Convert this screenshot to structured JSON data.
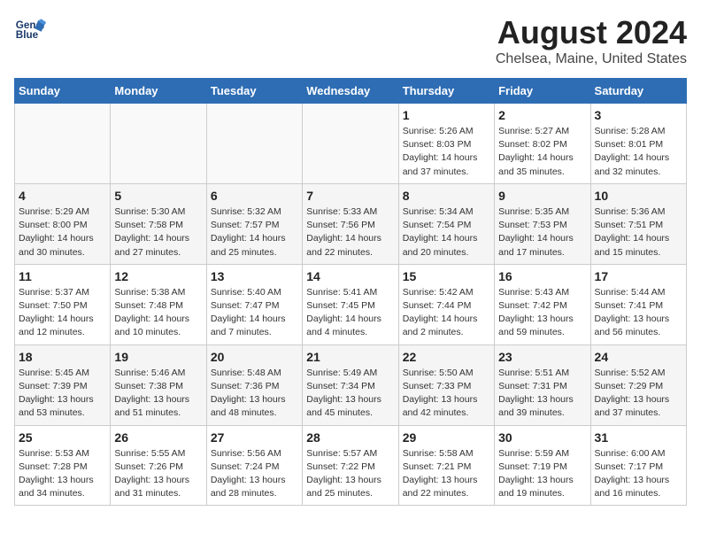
{
  "header": {
    "logo_line1": "General",
    "logo_line2": "Blue",
    "title": "August 2024",
    "subtitle": "Chelsea, Maine, United States"
  },
  "days_of_week": [
    "Sunday",
    "Monday",
    "Tuesday",
    "Wednesday",
    "Thursday",
    "Friday",
    "Saturday"
  ],
  "weeks": [
    [
      {
        "day": "",
        "info": ""
      },
      {
        "day": "",
        "info": ""
      },
      {
        "day": "",
        "info": ""
      },
      {
        "day": "",
        "info": ""
      },
      {
        "day": "1",
        "info": "Sunrise: 5:26 AM\nSunset: 8:03 PM\nDaylight: 14 hours\nand 37 minutes."
      },
      {
        "day": "2",
        "info": "Sunrise: 5:27 AM\nSunset: 8:02 PM\nDaylight: 14 hours\nand 35 minutes."
      },
      {
        "day": "3",
        "info": "Sunrise: 5:28 AM\nSunset: 8:01 PM\nDaylight: 14 hours\nand 32 minutes."
      }
    ],
    [
      {
        "day": "4",
        "info": "Sunrise: 5:29 AM\nSunset: 8:00 PM\nDaylight: 14 hours\nand 30 minutes."
      },
      {
        "day": "5",
        "info": "Sunrise: 5:30 AM\nSunset: 7:58 PM\nDaylight: 14 hours\nand 27 minutes."
      },
      {
        "day": "6",
        "info": "Sunrise: 5:32 AM\nSunset: 7:57 PM\nDaylight: 14 hours\nand 25 minutes."
      },
      {
        "day": "7",
        "info": "Sunrise: 5:33 AM\nSunset: 7:56 PM\nDaylight: 14 hours\nand 22 minutes."
      },
      {
        "day": "8",
        "info": "Sunrise: 5:34 AM\nSunset: 7:54 PM\nDaylight: 14 hours\nand 20 minutes."
      },
      {
        "day": "9",
        "info": "Sunrise: 5:35 AM\nSunset: 7:53 PM\nDaylight: 14 hours\nand 17 minutes."
      },
      {
        "day": "10",
        "info": "Sunrise: 5:36 AM\nSunset: 7:51 PM\nDaylight: 14 hours\nand 15 minutes."
      }
    ],
    [
      {
        "day": "11",
        "info": "Sunrise: 5:37 AM\nSunset: 7:50 PM\nDaylight: 14 hours\nand 12 minutes."
      },
      {
        "day": "12",
        "info": "Sunrise: 5:38 AM\nSunset: 7:48 PM\nDaylight: 14 hours\nand 10 minutes."
      },
      {
        "day": "13",
        "info": "Sunrise: 5:40 AM\nSunset: 7:47 PM\nDaylight: 14 hours\nand 7 minutes."
      },
      {
        "day": "14",
        "info": "Sunrise: 5:41 AM\nSunset: 7:45 PM\nDaylight: 14 hours\nand 4 minutes."
      },
      {
        "day": "15",
        "info": "Sunrise: 5:42 AM\nSunset: 7:44 PM\nDaylight: 14 hours\nand 2 minutes."
      },
      {
        "day": "16",
        "info": "Sunrise: 5:43 AM\nSunset: 7:42 PM\nDaylight: 13 hours\nand 59 minutes."
      },
      {
        "day": "17",
        "info": "Sunrise: 5:44 AM\nSunset: 7:41 PM\nDaylight: 13 hours\nand 56 minutes."
      }
    ],
    [
      {
        "day": "18",
        "info": "Sunrise: 5:45 AM\nSunset: 7:39 PM\nDaylight: 13 hours\nand 53 minutes."
      },
      {
        "day": "19",
        "info": "Sunrise: 5:46 AM\nSunset: 7:38 PM\nDaylight: 13 hours\nand 51 minutes."
      },
      {
        "day": "20",
        "info": "Sunrise: 5:48 AM\nSunset: 7:36 PM\nDaylight: 13 hours\nand 48 minutes."
      },
      {
        "day": "21",
        "info": "Sunrise: 5:49 AM\nSunset: 7:34 PM\nDaylight: 13 hours\nand 45 minutes."
      },
      {
        "day": "22",
        "info": "Sunrise: 5:50 AM\nSunset: 7:33 PM\nDaylight: 13 hours\nand 42 minutes."
      },
      {
        "day": "23",
        "info": "Sunrise: 5:51 AM\nSunset: 7:31 PM\nDaylight: 13 hours\nand 39 minutes."
      },
      {
        "day": "24",
        "info": "Sunrise: 5:52 AM\nSunset: 7:29 PM\nDaylight: 13 hours\nand 37 minutes."
      }
    ],
    [
      {
        "day": "25",
        "info": "Sunrise: 5:53 AM\nSunset: 7:28 PM\nDaylight: 13 hours\nand 34 minutes."
      },
      {
        "day": "26",
        "info": "Sunrise: 5:55 AM\nSunset: 7:26 PM\nDaylight: 13 hours\nand 31 minutes."
      },
      {
        "day": "27",
        "info": "Sunrise: 5:56 AM\nSunset: 7:24 PM\nDaylight: 13 hours\nand 28 minutes."
      },
      {
        "day": "28",
        "info": "Sunrise: 5:57 AM\nSunset: 7:22 PM\nDaylight: 13 hours\nand 25 minutes."
      },
      {
        "day": "29",
        "info": "Sunrise: 5:58 AM\nSunset: 7:21 PM\nDaylight: 13 hours\nand 22 minutes."
      },
      {
        "day": "30",
        "info": "Sunrise: 5:59 AM\nSunset: 7:19 PM\nDaylight: 13 hours\nand 19 minutes."
      },
      {
        "day": "31",
        "info": "Sunrise: 6:00 AM\nSunset: 7:17 PM\nDaylight: 13 hours\nand 16 minutes."
      }
    ]
  ]
}
